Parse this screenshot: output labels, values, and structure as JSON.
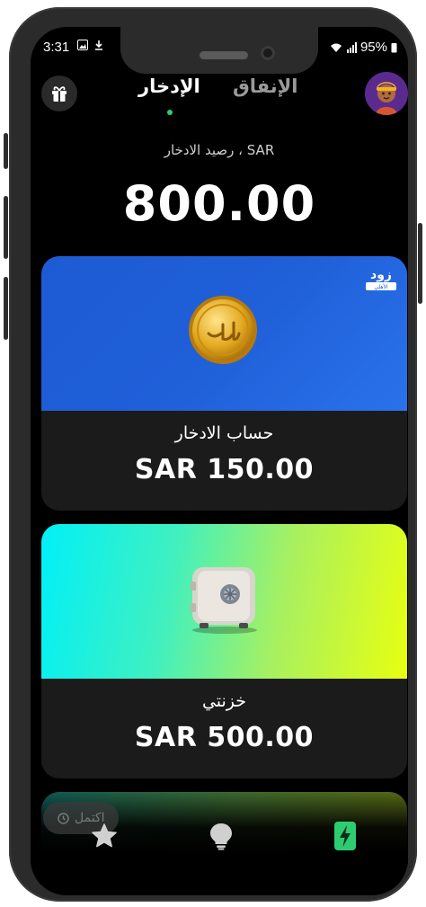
{
  "status_bar": {
    "time": "3:31",
    "battery": "95%"
  },
  "header": {
    "tab_save": "الإدخار",
    "tab_spend": "الإنفاق",
    "gift_icon": "gift-icon",
    "avatar_icon": "avatar-icon"
  },
  "balance": {
    "label": "رصيد الادخار ، SAR",
    "value": "800.00"
  },
  "cards": [
    {
      "title": "حساب الادخار",
      "amount": "SAR 150.00",
      "brand_name": "زود",
      "brand_sub": "الأهلي"
    },
    {
      "title": "خزنتي",
      "amount": "SAR 500.00"
    }
  ],
  "chip": {
    "label": "اكتمل"
  },
  "nav": {
    "items": [
      "star-icon",
      "lightbulb-icon",
      "bolt-icon"
    ]
  },
  "colors": {
    "accent": "#2ecc71",
    "card1_bg": "#1f5fd8",
    "card2_gradient_start": "#00f0f8",
    "card2_gradient_end": "#e8ff10"
  }
}
